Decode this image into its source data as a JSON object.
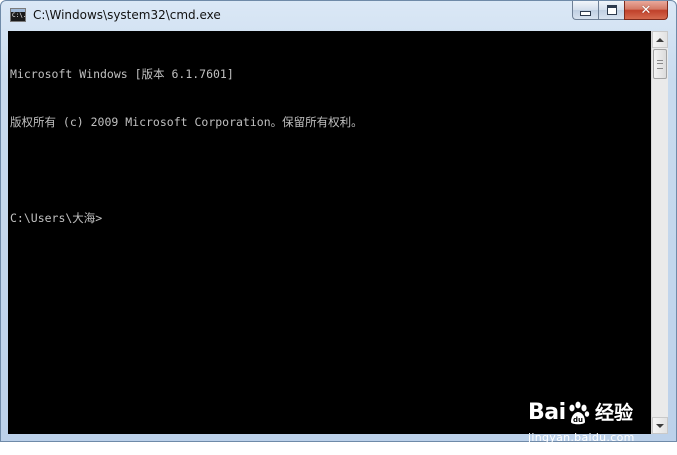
{
  "window": {
    "title": "C:\\Windows\\system32\\cmd.exe",
    "app_icon": "cmd-icon",
    "app_icon_text": "C:\\.",
    "controls": {
      "minimize_icon": "minimize-icon",
      "maximize_icon": "maximize-icon",
      "close_icon": "close-icon",
      "close_glyph": "✕"
    }
  },
  "console": {
    "lines": [
      "Microsoft Windows [版本 6.1.7601]",
      "版权所有 (c) 2009 Microsoft Corporation。保留所有权利。",
      "",
      "C:\\Users\\大海>"
    ],
    "background": "#000000",
    "foreground": "#c0c0c0"
  },
  "scrollbar": {
    "up_icon": "scroll-up-arrow-icon",
    "down_icon": "scroll-down-arrow-icon"
  },
  "watermark": {
    "brand_left": "Bai",
    "brand_icon": "baidu-paw-icon",
    "brand_right": "经验",
    "url": "jingyan.baidu.com"
  }
}
